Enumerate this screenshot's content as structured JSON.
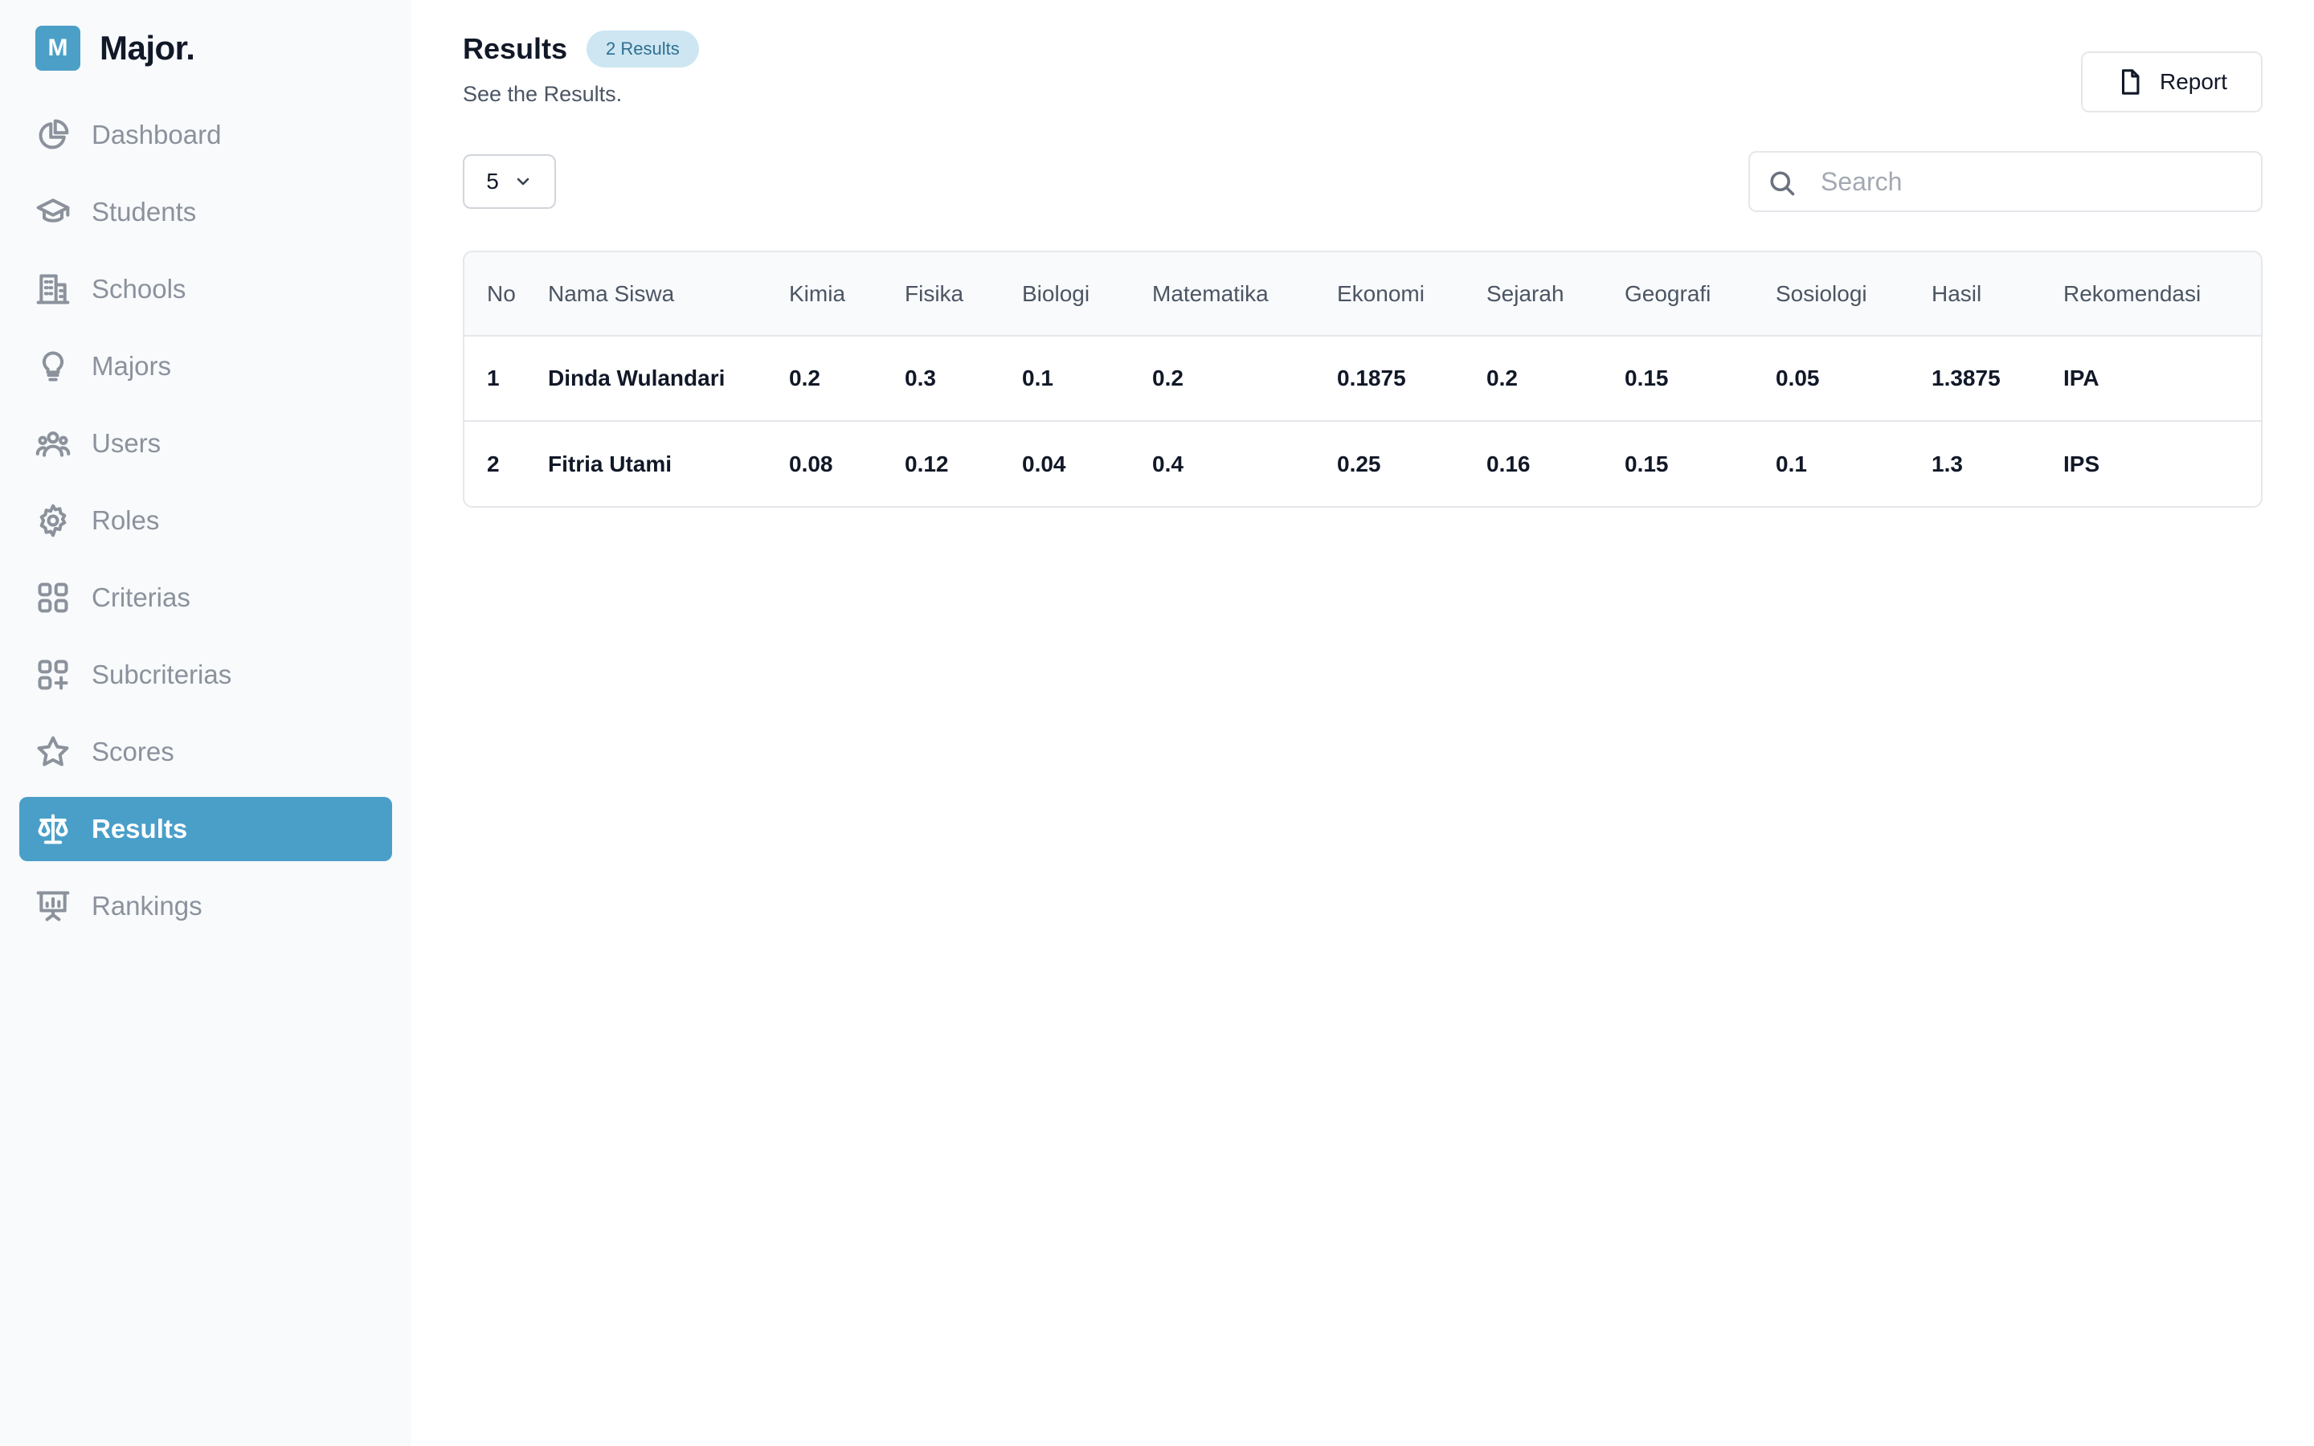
{
  "brand": {
    "logo_letter": "M",
    "name": "Major."
  },
  "sidebar": {
    "items": [
      {
        "label": "Dashboard",
        "icon": "pie-chart-icon"
      },
      {
        "label": "Students",
        "icon": "graduation-cap-icon"
      },
      {
        "label": "Schools",
        "icon": "building-icon"
      },
      {
        "label": "Majors",
        "icon": "lightbulb-icon"
      },
      {
        "label": "Users",
        "icon": "users-icon"
      },
      {
        "label": "Roles",
        "icon": "settings-icon"
      },
      {
        "label": "Criterias",
        "icon": "grid-icon"
      },
      {
        "label": "Subcriterias",
        "icon": "grid-plus-icon"
      },
      {
        "label": "Scores",
        "icon": "star-icon"
      },
      {
        "label": "Results",
        "icon": "scale-icon",
        "active": true
      },
      {
        "label": "Rankings",
        "icon": "presentation-chart-icon"
      }
    ]
  },
  "header": {
    "title": "Results",
    "badge": "2 Results",
    "subtitle": "See the Results.",
    "report_label": "Report"
  },
  "controls": {
    "page_size": "5",
    "search_placeholder": "Search"
  },
  "table": {
    "columns": [
      "No",
      "Nama Siswa",
      "Kimia",
      "Fisika",
      "Biologi",
      "Matematika",
      "Ekonomi",
      "Sejarah",
      "Geografi",
      "Sosiologi",
      "Hasil",
      "Rekomendasi"
    ],
    "rows": [
      [
        "1",
        "Dinda Wulandari",
        "0.2",
        "0.3",
        "0.1",
        "0.2",
        "0.1875",
        "0.2",
        "0.15",
        "0.05",
        "1.3875",
        "IPA"
      ],
      [
        "2",
        "Fitria Utami",
        "0.08",
        "0.12",
        "0.04",
        "0.4",
        "0.25",
        "0.16",
        "0.15",
        "0.1",
        "1.3",
        "IPS"
      ]
    ]
  },
  "colors": {
    "accent": "#4a9fc9",
    "badge_bg": "#cde6f2",
    "badge_text": "#2f6f91",
    "sidebar_bg": "#f8fafc",
    "muted_text": "#8b929c"
  }
}
